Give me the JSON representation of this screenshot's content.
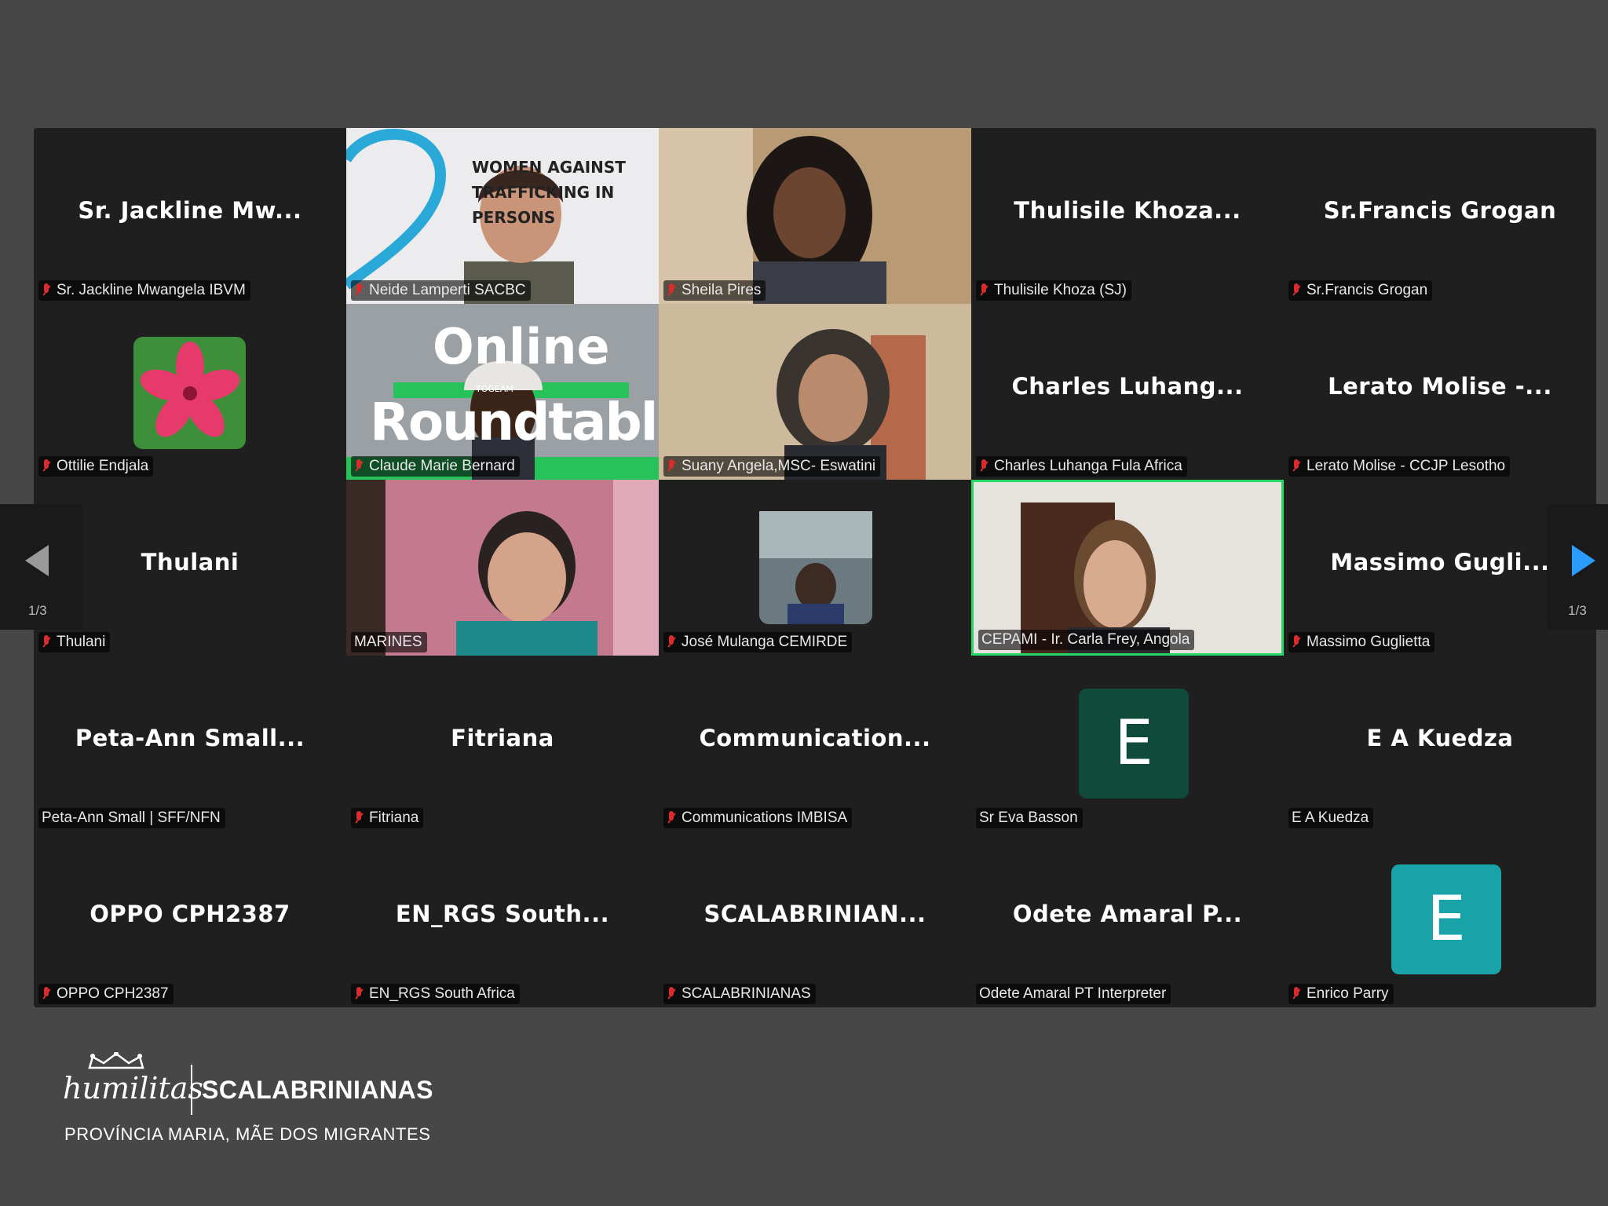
{
  "gallery": {
    "tiles": [
      {
        "title": "Sr. Jackline Mw...",
        "label": "Sr. Jackline Mwangela IBVM",
        "muted": true
      },
      {
        "title": "",
        "label": "Neide Lamperti SACBC",
        "muted": true
      },
      {
        "title": "",
        "label": "Sheila Pires",
        "muted": true
      },
      {
        "title": "Thulisile Khoza...",
        "label": "Thulisile Khoza (SJ)",
        "muted": true
      },
      {
        "title": "Sr.Francis Grogan",
        "label": "Sr.Francis Grogan",
        "muted": true
      },
      {
        "title": "",
        "label": "Ottilie Endjala",
        "muted": true
      },
      {
        "title": "",
        "label": "Claude Marie Bernard",
        "muted": true
      },
      {
        "title": "",
        "label": "Suany Angela,MSC- Eswatini",
        "muted": true
      },
      {
        "title": "Charles Luhang...",
        "label": "Charles Luhanga Fula Africa",
        "muted": true
      },
      {
        "title": "Lerato Molise -...",
        "label": "Lerato Molise - CCJP Lesotho",
        "muted": true
      },
      {
        "title": "Thulani",
        "label": "Thulani",
        "muted": true
      },
      {
        "title": "",
        "label": "MARINES",
        "muted": false
      },
      {
        "title": "",
        "label": "José Mulanga CEMIRDE",
        "muted": true
      },
      {
        "title": "",
        "label": "CEPAMI - Ir. Carla Frey, Angola",
        "muted": false
      },
      {
        "title": "Massimo Gugli...",
        "label": "Massimo Guglietta",
        "muted": true
      },
      {
        "title": "Peta-Ann Small...",
        "label": "Peta-Ann Small | SFF/NFN",
        "muted": false
      },
      {
        "title": "Fitriana",
        "label": "Fitriana",
        "muted": true
      },
      {
        "title": "Communication...",
        "label": "Communications IMBISA",
        "muted": true
      },
      {
        "title": "",
        "label": "Sr Eva Basson",
        "muted": false,
        "avatar": "E"
      },
      {
        "title": "E A Kuedza",
        "label": "E A Kuedza",
        "muted": false
      },
      {
        "title": "OPPO CPH2387",
        "label": "OPPO CPH2387",
        "muted": true
      },
      {
        "title": "EN_RGS South...",
        "label": "EN_RGS South Africa",
        "muted": true
      },
      {
        "title": "SCALABRINIAN...",
        "label": "SCALABRINIANAS",
        "muted": true
      },
      {
        "title": "Odete Amaral P...",
        "label": "Odete Amaral PT Interpreter",
        "muted": false
      },
      {
        "title": "",
        "label": "Enrico Parry",
        "muted": true,
        "avatar": "E"
      }
    ],
    "backdrop_text": {
      "poster_top": "WOMEN AGAINST TRAFFICKING IN PERSONS",
      "roundtable_line1": "Online",
      "roundtable_tag": "TOGEAM",
      "roundtable_line2": "Roundtable"
    }
  },
  "navigation": {
    "prev_page": "1/3",
    "next_page": "1/3",
    "prev_icon": "arrow-left-icon",
    "next_icon": "arrow-right-icon"
  },
  "footer": {
    "logo_text": "humilitas",
    "brand": "SCALABRINIANAS",
    "tagline": "PROVÍNCIA MARIA, MÃE DOS MIGRANTES"
  },
  "colors": {
    "background": "#474747",
    "tile": "#1f1f1f",
    "active_speaker": "#23d966",
    "avatar_green": "#0f4a3a",
    "avatar_teal": "#17a3a8",
    "mic_muted": "#d92c2c",
    "nav_arrow_right": "#2a9bff"
  }
}
